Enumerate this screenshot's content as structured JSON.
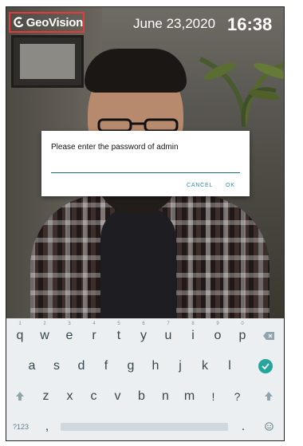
{
  "status": {
    "brand": "GeoVision",
    "date": "June 23,2020",
    "time": "16:38"
  },
  "dialog": {
    "message": "Please enter the password of admin",
    "password_value": "",
    "cancel_label": "CANCEL",
    "ok_label": "OK"
  },
  "keyboard": {
    "row1": [
      {
        "key": "q",
        "hint": "1"
      },
      {
        "key": "w",
        "hint": "2"
      },
      {
        "key": "e",
        "hint": "3"
      },
      {
        "key": "r",
        "hint": "4"
      },
      {
        "key": "t",
        "hint": "5"
      },
      {
        "key": "y",
        "hint": "6"
      },
      {
        "key": "u",
        "hint": "7"
      },
      {
        "key": "i",
        "hint": "8"
      },
      {
        "key": "o",
        "hint": "9"
      },
      {
        "key": "p",
        "hint": "0"
      }
    ],
    "row2": [
      "a",
      "s",
      "d",
      "f",
      "g",
      "h",
      "j",
      "k",
      "l"
    ],
    "row3": [
      "z",
      "x",
      "c",
      "v",
      "b",
      "n",
      "m",
      "!",
      "?"
    ],
    "symbols_label": "?123",
    "comma": ",",
    "period": "."
  },
  "icons": {
    "backspace": "backspace-icon",
    "enter": "check-icon",
    "shift": "shift-icon",
    "emoji": "emoji-icon"
  },
  "colors": {
    "logo_box": "#e23b3b",
    "accent": "#2a8fa6",
    "enter_key": "#26a69a"
  }
}
